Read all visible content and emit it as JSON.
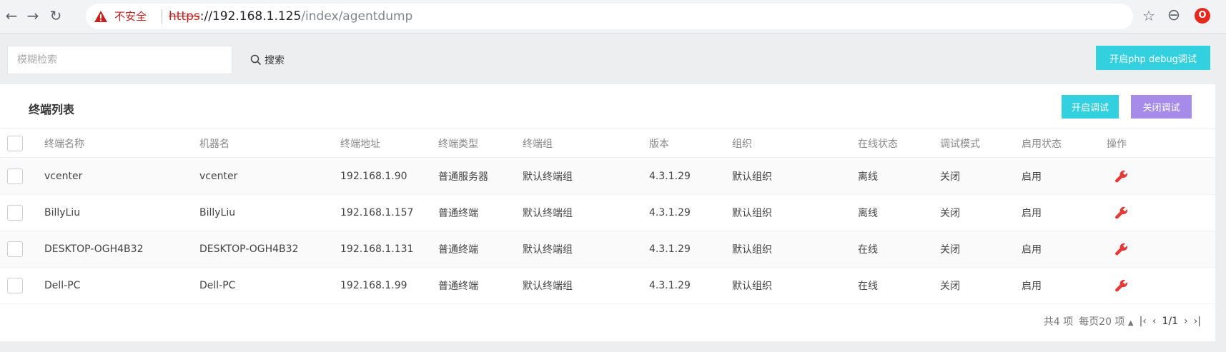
{
  "browser": {
    "back_icon": "arrow-left-icon",
    "forward_icon": "arrow-right-icon",
    "reload_icon": "reload-icon",
    "insecure_label": "不安全",
    "url_scheme": "https",
    "url_host": "://192.168.1.125",
    "url_path": "/index/agentdump",
    "star_icon": "star-icon",
    "account_icon": "account-icon",
    "extension_icon": "extension-icon"
  },
  "toolbar": {
    "search_placeholder": "模糊检索",
    "search_label": "搜索",
    "php_debug_label": "开启php debug调试"
  },
  "card": {
    "title": "终端列表",
    "enable_debug_label": "开启调试",
    "disable_debug_label": "关闭调试"
  },
  "table": {
    "headers": [
      "终端名称",
      "机器名",
      "终端地址",
      "终端类型",
      "终端组",
      "版本",
      "组织",
      "在线状态",
      "调试模式",
      "启用状态",
      "操作"
    ],
    "rows": [
      [
        "vcenter",
        "vcenter",
        "192.168.1.90",
        "普通服务器",
        "默认终端组",
        "4.3.1.29",
        "默认组织",
        "离线",
        "关闭",
        "启用"
      ],
      [
        "BillyLiu",
        "BillyLiu",
        "192.168.1.157",
        "普通终端",
        "默认终端组",
        "4.3.1.29",
        "默认组织",
        "离线",
        "关闭",
        "启用"
      ],
      [
        "DESKTOP-OGH4B32",
        "DESKTOP-OGH4B32",
        "192.168.1.131",
        "普通终端",
        "默认终端组",
        "4.3.1.29",
        "默认组织",
        "在线",
        "关闭",
        "启用"
      ],
      [
        "Dell-PC",
        "Dell-PC",
        "192.168.1.99",
        "普通终端",
        "默认终端组",
        "4.3.1.29",
        "默认组织",
        "在线",
        "关闭",
        "启用"
      ]
    ],
    "action_icon": "wrench-icon"
  },
  "pagination": {
    "total_label": "共4 项",
    "per_page_label": "每页20 项",
    "page_label": "1/1"
  },
  "colors": {
    "accent_cyan": "#33d0e0",
    "accent_purple": "#a78be8",
    "wrench_red": "#e53935"
  }
}
